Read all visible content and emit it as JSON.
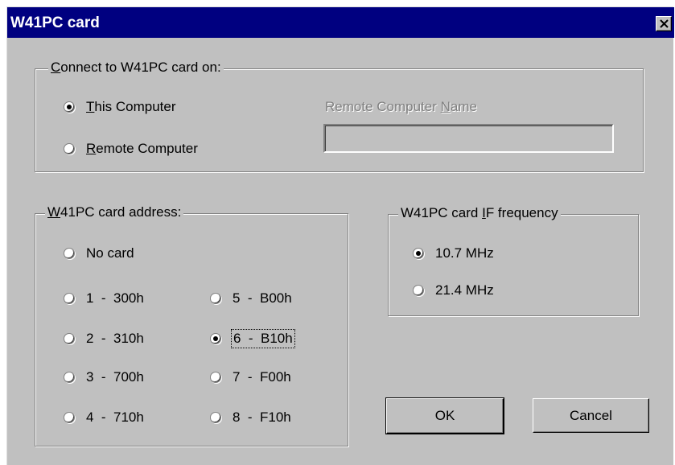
{
  "window": {
    "title": "W41PC card"
  },
  "connect_group": {
    "legend_prefix": "",
    "legend_accel": "C",
    "legend_rest": "onnect to W41PC card on:",
    "options": [
      {
        "accel": "T",
        "rest": "his Computer",
        "checked": true
      },
      {
        "accel": "R",
        "rest": "emote Computer",
        "checked": false
      }
    ],
    "remote_name_label_pre": "Remote Computer ",
    "remote_name_label_accel": "N",
    "remote_name_label_post": "ame",
    "remote_name_value": ""
  },
  "address_group": {
    "legend_accel": "W",
    "legend_rest": "41PC card address:",
    "no_card": "No card",
    "left": [
      "1  -  300h",
      "2  -  310h",
      "3  -  700h",
      "4  -  710h"
    ],
    "right": [
      "5  -  B00h",
      "6  -  B10h",
      "7  -  F00h",
      "8  -  F10h"
    ],
    "selected": "6  -  B10h"
  },
  "freq_group": {
    "legend_pre": "W41PC card ",
    "legend_accel": "I",
    "legend_post": "F frequency",
    "options": [
      "10.7 MHz",
      "21.4 MHz"
    ],
    "selected": "10.7 MHz"
  },
  "buttons": {
    "ok": "OK",
    "cancel": "Cancel"
  }
}
